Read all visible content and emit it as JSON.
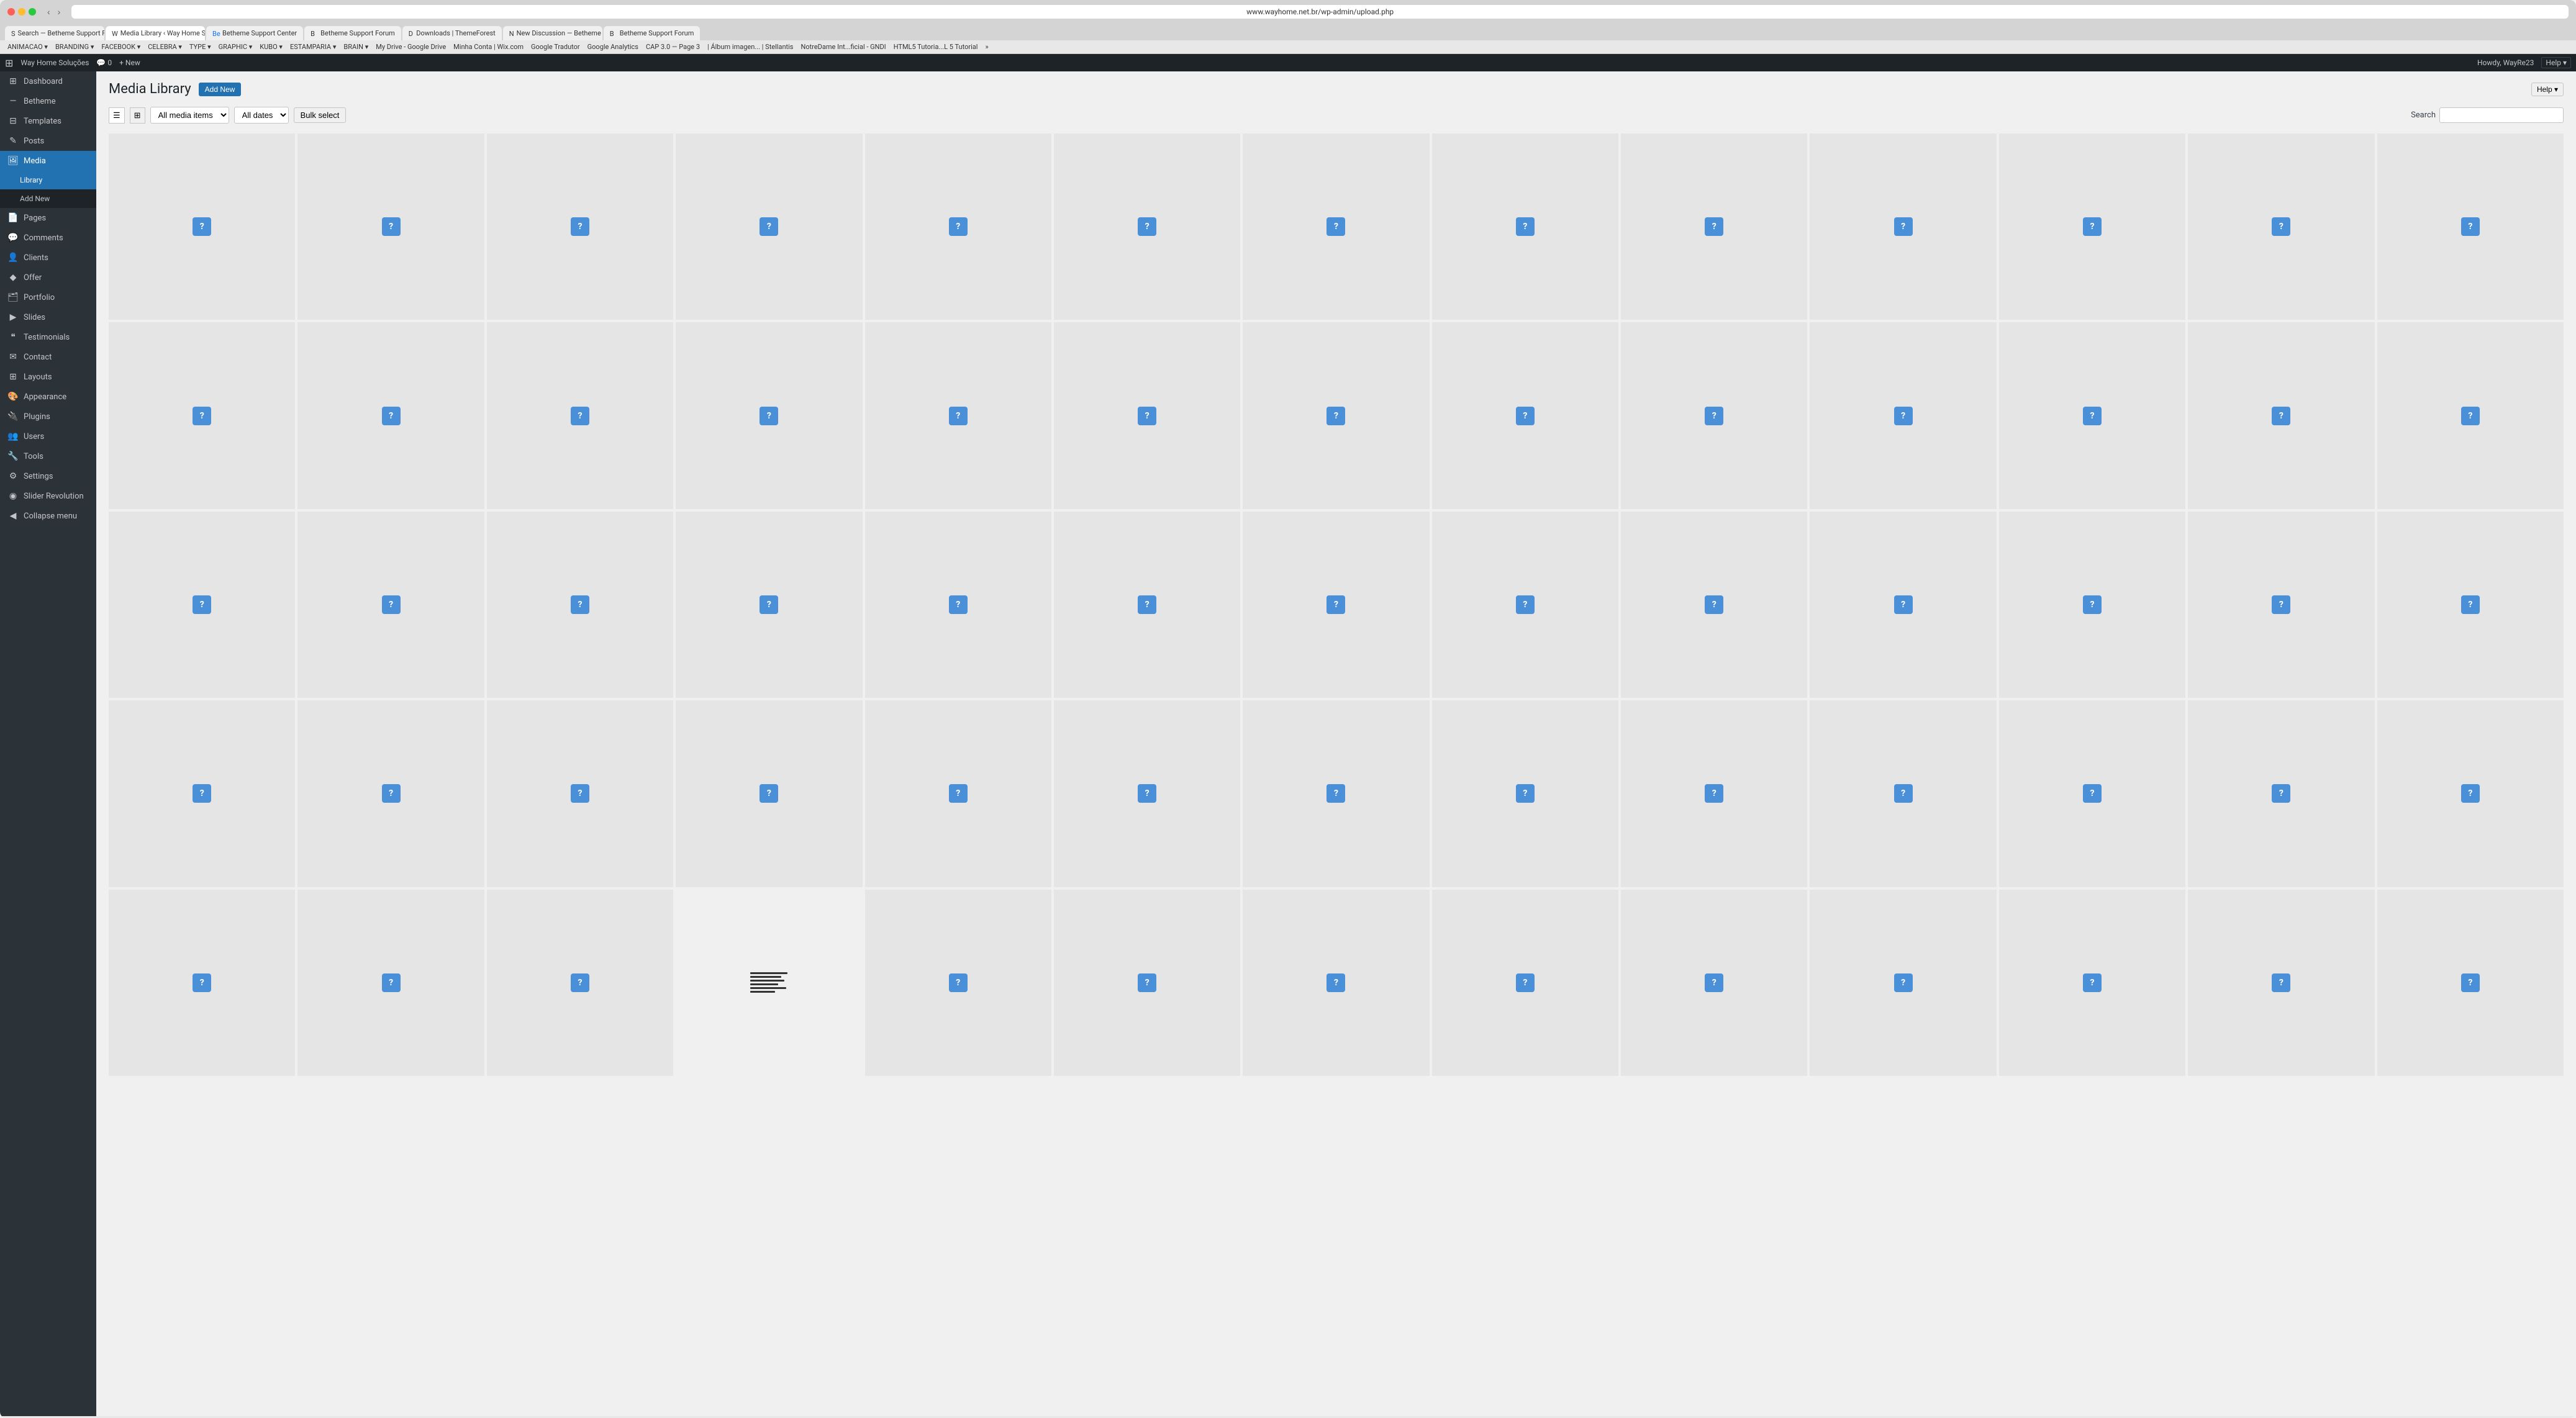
{
  "browser": {
    "dots": [
      "red",
      "yellow",
      "green"
    ],
    "address": "www.wayhome.net.br/wp-admin/upload.php",
    "tabs": [
      {
        "label": "Search — Betheme Support Forum",
        "favicon": "S",
        "active": false
      },
      {
        "label": "Media Library ‹ Way Home Soluções —...",
        "favicon": "W",
        "active": true
      },
      {
        "label": "Betheme Support Center",
        "favicon": "Be",
        "active": false
      },
      {
        "label": "Betheme Support Forum",
        "favicon": "B",
        "active": false
      },
      {
        "label": "Downloads | ThemeForest",
        "favicon": "D",
        "active": false
      },
      {
        "label": "New Discussion — Betheme Support Fo...",
        "favicon": "N",
        "active": false
      },
      {
        "label": "Betheme Support Forum",
        "favicon": "B",
        "active": false
      }
    ]
  },
  "bookmarks": [
    "ANIMACAO",
    "BRANDING",
    "FACEBOOK",
    "CELEBRA",
    "TYPE",
    "GRAPHIC",
    "KUBO",
    "ESTAMPARIA",
    "BRAIN",
    "My Drive - Google Drive",
    "Minha Conta | Wix.com",
    "Google Tradutor",
    "Google Analytics",
    "CAP 3.0 — Page 3",
    "| Álbum imagen... | Stellantis",
    "NotreDame Int...ficial - GNDI",
    "HTML5 Tutoria...L 5 Tutorial"
  ],
  "toolbar": {
    "wp_icon": "⊞",
    "site_name": "Way Home Soluções",
    "comments_icon": "💬",
    "comments_count": "0",
    "new_label": "+ New",
    "help_label": "Help ▾",
    "user_label": "Howdy, WayRe23"
  },
  "sidebar": {
    "items": [
      {
        "label": "Dashboard",
        "icon": "⊞",
        "active": false
      },
      {
        "label": "Betheme",
        "icon": "—",
        "active": false
      },
      {
        "label": "Templates",
        "icon": "⊟",
        "active": false
      },
      {
        "label": "Posts",
        "icon": "✎",
        "active": false
      },
      {
        "label": "Media",
        "icon": "🖼",
        "active": true
      },
      {
        "label": "Library",
        "sub": true,
        "active": true
      },
      {
        "label": "Add New",
        "sub": true,
        "active": false
      },
      {
        "label": "Pages",
        "icon": "📄",
        "active": false
      },
      {
        "label": "Comments",
        "icon": "💬",
        "active": false
      },
      {
        "label": "Clients",
        "icon": "👤",
        "active": false
      },
      {
        "label": "Offer",
        "icon": "◆",
        "active": false
      },
      {
        "label": "Portfolio",
        "icon": "🗂",
        "active": false
      },
      {
        "label": "Slides",
        "icon": "▶",
        "active": false
      },
      {
        "label": "Testimonials",
        "icon": "❝",
        "active": false
      },
      {
        "label": "Contact",
        "icon": "✉",
        "active": false
      },
      {
        "label": "Layouts",
        "icon": "⊞",
        "active": false
      },
      {
        "label": "Appearance",
        "icon": "🎨",
        "active": false
      },
      {
        "label": "Plugins",
        "icon": "🔌",
        "active": false
      },
      {
        "label": "Users",
        "icon": "👥",
        "active": false
      },
      {
        "label": "Tools",
        "icon": "🔧",
        "active": false
      },
      {
        "label": "Settings",
        "icon": "⚙",
        "active": false
      },
      {
        "label": "Slider Revolution",
        "icon": "◉",
        "active": false
      },
      {
        "label": "Collapse menu",
        "icon": "◀",
        "active": false
      }
    ]
  },
  "main": {
    "title": "Media Library",
    "add_new_label": "Add New",
    "filter": {
      "media_type_label": "All media items",
      "date_label": "All dates",
      "bulk_select_label": "Bulk select"
    },
    "search": {
      "label": "Search",
      "placeholder": ""
    },
    "media_count": 65
  }
}
